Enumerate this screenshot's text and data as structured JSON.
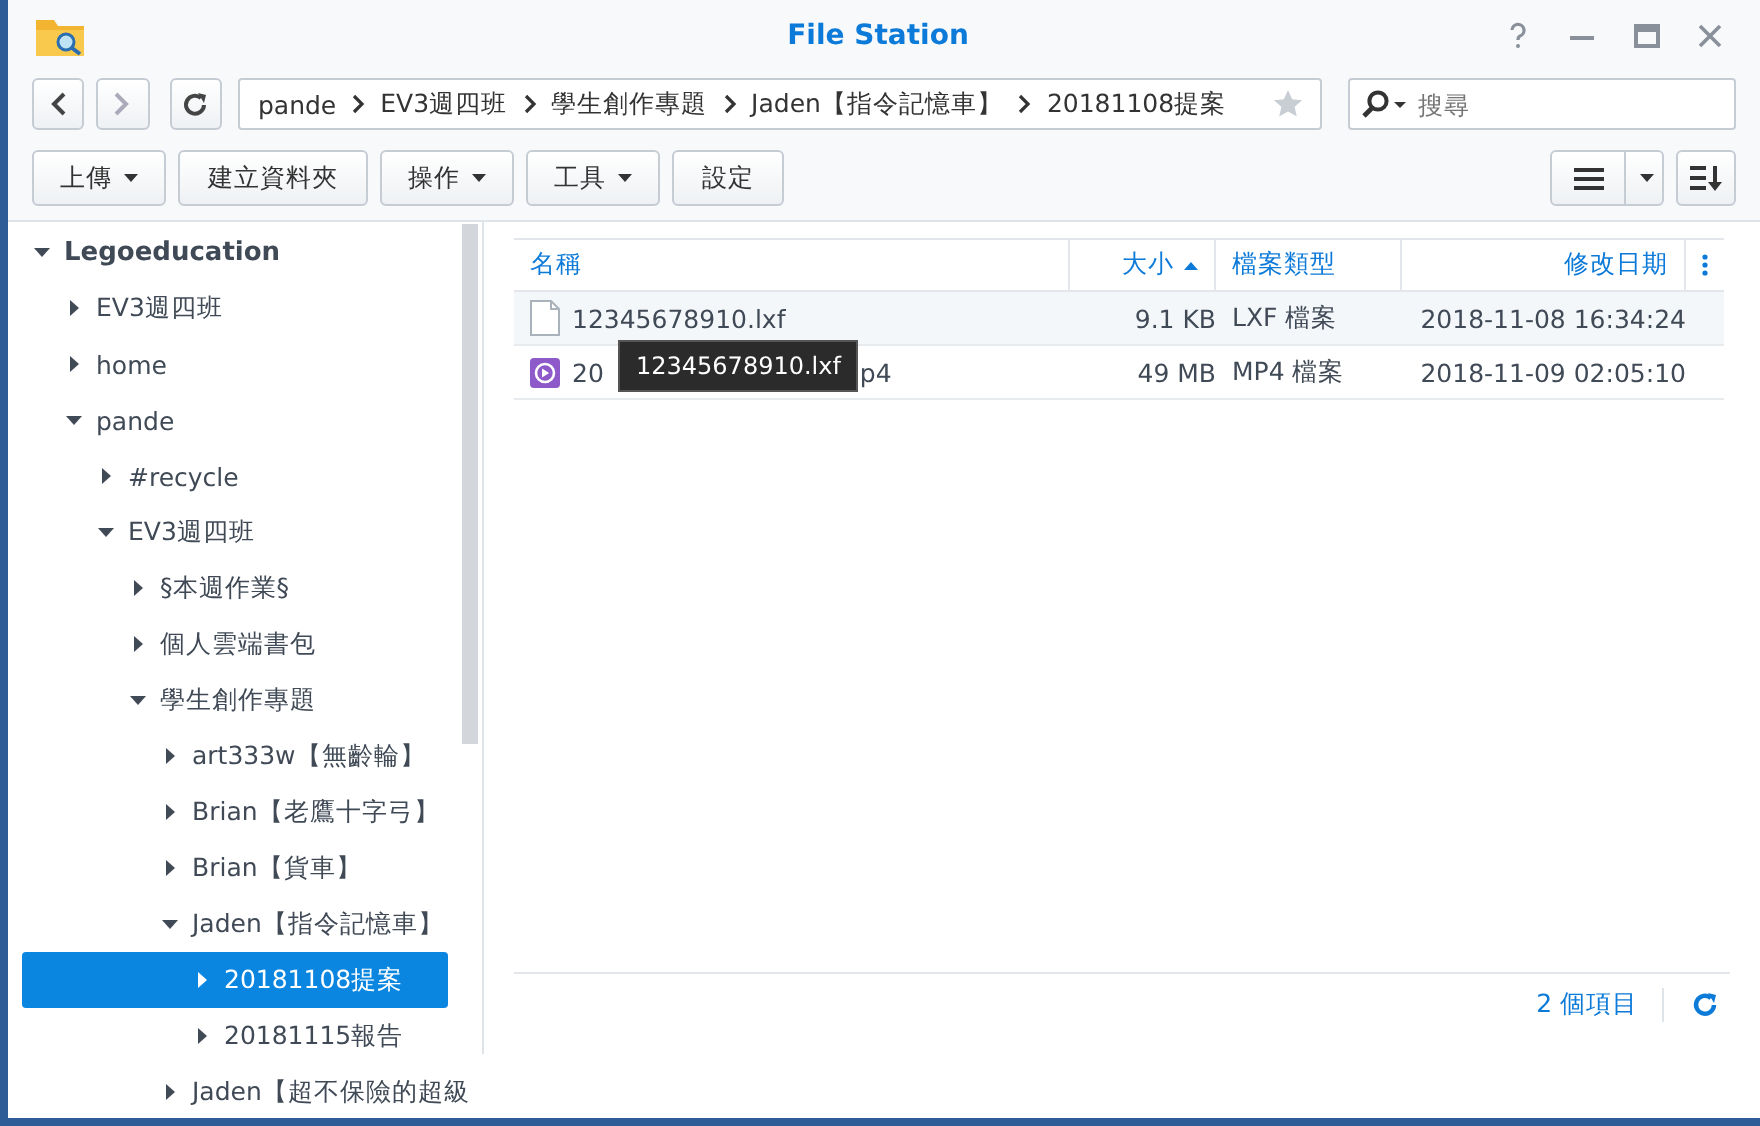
{
  "window": {
    "title": "File Station"
  },
  "nav": {
    "path": [
      {
        "label": "pande"
      },
      {
        "label": "EV3週四班"
      },
      {
        "label": "學生創作專題"
      },
      {
        "label": "Jaden【指令記憶車】"
      },
      {
        "label": "20181108提案"
      }
    ],
    "search": {
      "placeholder": "搜尋"
    }
  },
  "toolbar": {
    "buttons": [
      {
        "label": "上傳",
        "dropdown": true
      },
      {
        "label": "建立資料夾",
        "dropdown": false
      },
      {
        "label": "操作",
        "dropdown": true
      },
      {
        "label": "工具",
        "dropdown": true
      },
      {
        "label": "設定",
        "dropdown": false
      }
    ]
  },
  "tree": [
    {
      "label": "Legoeducation",
      "expanded": true,
      "selected": false,
      "children": [
        {
          "label": "EV3週四班",
          "expanded": false,
          "selected": false
        },
        {
          "label": "home",
          "expanded": false,
          "selected": false
        },
        {
          "label": "pande",
          "expanded": true,
          "selected": false,
          "children": [
            {
              "label": "#recycle",
              "expanded": false,
              "selected": false
            },
            {
              "label": "EV3週四班",
              "expanded": true,
              "selected": false,
              "children": [
                {
                  "label": "§本週作業§",
                  "expanded": false,
                  "selected": false
                },
                {
                  "label": "個人雲端書包",
                  "expanded": false,
                  "selected": false
                },
                {
                  "label": "學生創作專題",
                  "expanded": true,
                  "selected": false,
                  "children": [
                    {
                      "label": "art333w【無齡輪】",
                      "expanded": false,
                      "selected": false
                    },
                    {
                      "label": "Brian【老鷹十字弓】",
                      "expanded": false,
                      "selected": false
                    },
                    {
                      "label": "Brian【貨車】",
                      "expanded": false,
                      "selected": false
                    },
                    {
                      "label": "Jaden【指令記憶車】",
                      "expanded": true,
                      "selected": false,
                      "children": [
                        {
                          "label": "20181108提案",
                          "expanded": false,
                          "selected": true
                        },
                        {
                          "label": "20181115報告",
                          "expanded": false,
                          "selected": false
                        }
                      ]
                    },
                    {
                      "label": "Jaden【超不保險的超級",
                      "expanded": false,
                      "selected": false
                    }
                  ]
                }
              ]
            }
          ]
        }
      ]
    }
  ],
  "table": {
    "columns": [
      {
        "label": "名稱",
        "sorted": false
      },
      {
        "label": "大小",
        "sorted": true
      },
      {
        "label": "檔案類型",
        "sorted": false
      },
      {
        "label": "修改日期",
        "sorted": false
      }
    ],
    "rows": [
      {
        "kind": "document",
        "name": "12345678910.lxf",
        "size": "9.1 KB",
        "type": "LXF 檔案",
        "modified": "2018-11-08 16:34:24"
      },
      {
        "kind": "video",
        "name": "20",
        "name_tail": "p4",
        "size": "49 MB",
        "type": "MP4 檔案",
        "modified": "2018-11-09 02:05:10"
      }
    ]
  },
  "tooltip": {
    "text": "12345678910.lxf"
  },
  "status_bar": {
    "count": "2 個項目"
  }
}
